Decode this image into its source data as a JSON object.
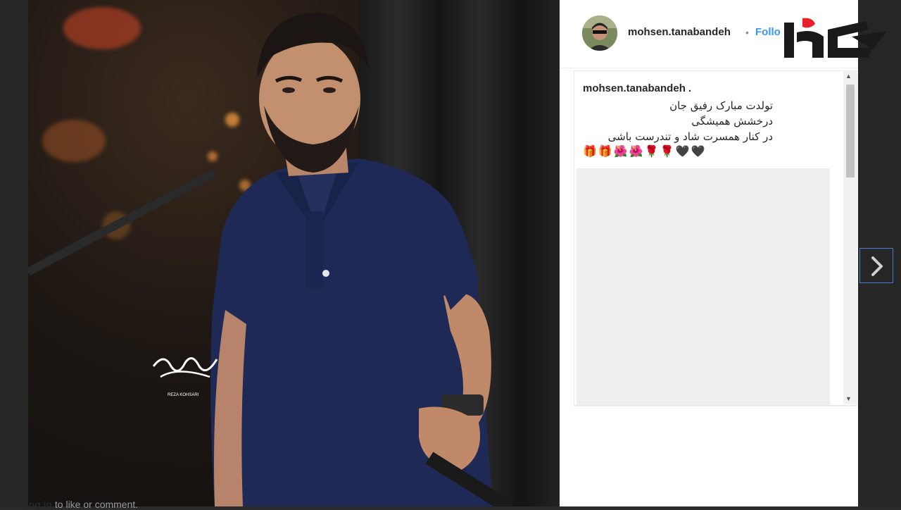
{
  "post": {
    "username": "mohsen.tanabandeh",
    "separator": "•",
    "follow_label": "Follo",
    "caption_user": "mohsen.tanabandeh .",
    "caption_lines": [
      "تولدت مبارک رفیق جان",
      "درخشش همیشگی",
      "در کنار همسرت شاد و تندرست باشی"
    ],
    "emojis": [
      "🎁",
      "🎁",
      "🌺",
      "🌺",
      "🌹",
      "🌹",
      "🖤",
      "🖤"
    ],
    "login_bold": "Log in",
    "login_rest": " to like or comment."
  },
  "photo": {
    "signature_caption": "REZA KOHSARI"
  },
  "colors": {
    "follow": "#3897f0",
    "logo_red": "#e8202a",
    "logo_black": "#1a1a1a",
    "shirt": "#1e2a55"
  },
  "icons": {
    "next": "chevron-right-icon",
    "scroll_up": "triangle-up-icon",
    "scroll_down": "triangle-down-icon"
  }
}
